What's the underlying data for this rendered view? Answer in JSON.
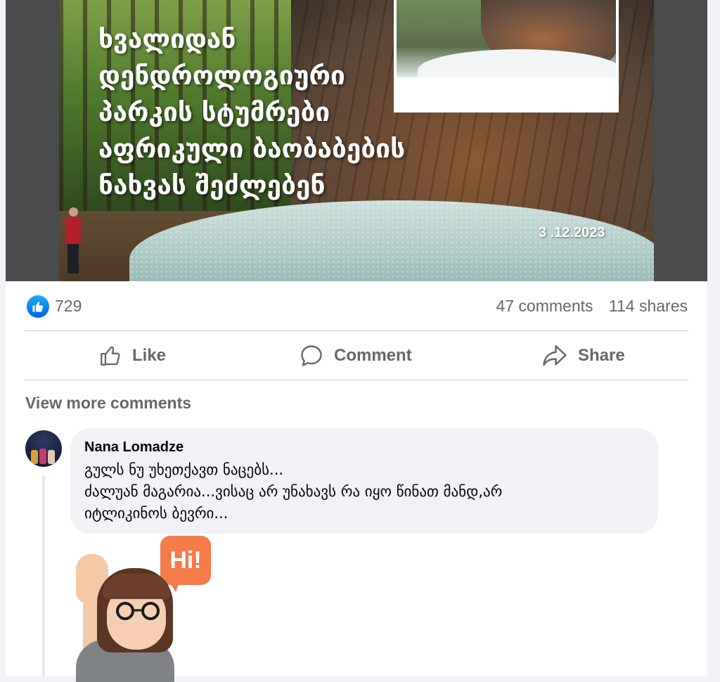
{
  "post": {
    "image": {
      "headline_lines": [
        "ხვალიდან",
        "დენდროლოგიური",
        "პარკის სტუმრები",
        "აფრიკული ბაობაბების",
        "ნახვას შეძლებენ"
      ],
      "date": "3 .12.2023"
    },
    "stats": {
      "likes": "729",
      "comments": "47 comments",
      "shares": "114 shares"
    },
    "actions": {
      "like": "Like",
      "comment": "Comment",
      "share": "Share"
    }
  },
  "comments": {
    "view_more": "View more comments",
    "items": [
      {
        "author": "Nana Lomadze",
        "lines": [
          "გულს ნუ უხეთქავთ ნაცებს...",
          "ძალუან მაგარია...ვისაც არ უნახავს რა იყო წინათ მანდ,არ",
          "იტლიკინოს ბევრი..."
        ],
        "sticker_text": "Hi!"
      }
    ]
  },
  "colors": {
    "like_blue": "#0866ff",
    "secondary_text": "#65676b",
    "bubble_bg": "#f0f2f5",
    "sticker_orange": "#f47a4a"
  }
}
